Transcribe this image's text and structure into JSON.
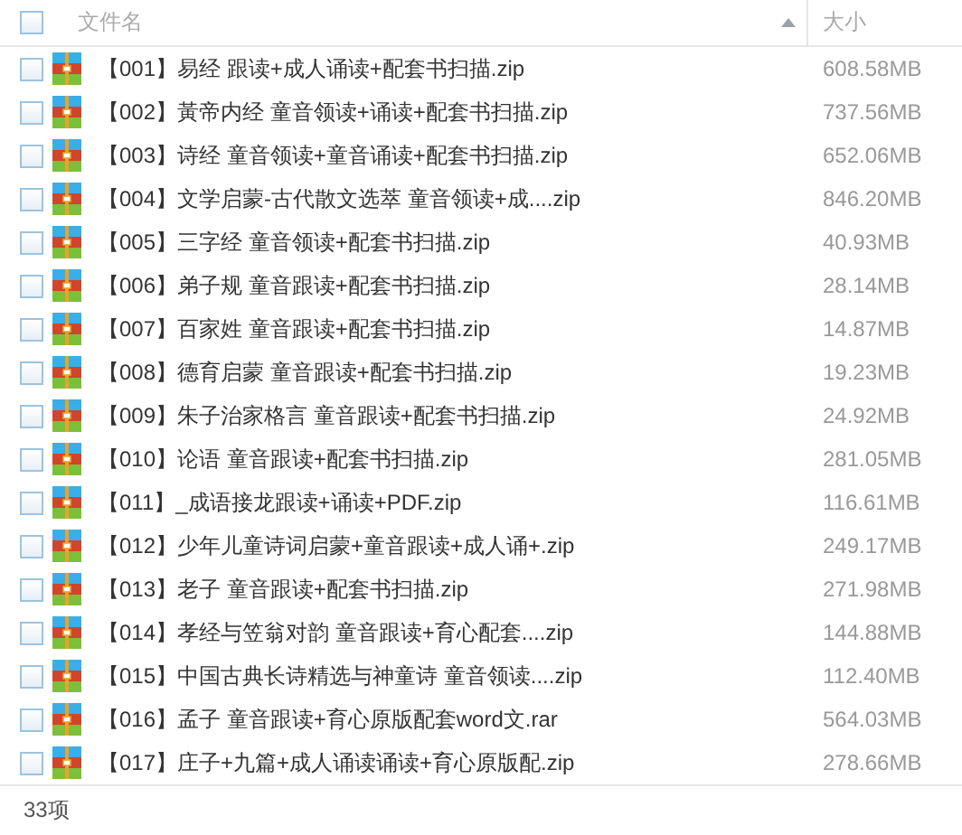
{
  "header": {
    "checked": false,
    "name_column": "文件名",
    "size_column": "大小",
    "sort_ascending": true
  },
  "files": [
    {
      "name": "【001】易经 跟读+成人诵读+配套书扫描.zip",
      "size": "608.58MB",
      "checked": false
    },
    {
      "name": "【002】黃帝内经 童音领读+诵读+配套书扫描.zip",
      "size": "737.56MB",
      "checked": false
    },
    {
      "name": "【003】诗经 童音领读+童音诵读+配套书扫描.zip",
      "size": "652.06MB",
      "checked": false
    },
    {
      "name": "【004】文学启蒙-古代散文选萃 童音领读+成....zip",
      "size": "846.20MB",
      "checked": false
    },
    {
      "name": "【005】三字经 童音领读+配套书扫描.zip",
      "size": "40.93MB",
      "checked": false
    },
    {
      "name": "【006】弟子规 童音跟读+配套书扫描.zip",
      "size": "28.14MB",
      "checked": false
    },
    {
      "name": "【007】百家姓 童音跟读+配套书扫描.zip",
      "size": "14.87MB",
      "checked": false
    },
    {
      "name": "【008】德育启蒙 童音跟读+配套书扫描.zip",
      "size": "19.23MB",
      "checked": false
    },
    {
      "name": "【009】朱子治家格言 童音跟读+配套书扫描.zip",
      "size": "24.92MB",
      "checked": false
    },
    {
      "name": "【010】论语 童音跟读+配套书扫描.zip",
      "size": "281.05MB",
      "checked": false
    },
    {
      "name": "【011】_成语接龙跟读+诵读+PDF.zip",
      "size": "116.61MB",
      "checked": false
    },
    {
      "name": "【012】少年儿童诗词启蒙+童音跟读+成人诵+.zip",
      "size": "249.17MB",
      "checked": false
    },
    {
      "name": "【013】老子 童音跟读+配套书扫描.zip",
      "size": "271.98MB",
      "checked": false
    },
    {
      "name": "【014】孝经与笠翁对韵 童音跟读+育心配套....zip",
      "size": "144.88MB",
      "checked": false
    },
    {
      "name": "【015】中国古典长诗精选与神童诗 童音领读....zip",
      "size": "112.40MB",
      "checked": false
    },
    {
      "name": "【016】孟子 童音跟读+育心原版配套word文.rar",
      "size": "564.03MB",
      "checked": false
    },
    {
      "name": "【017】庄子+九篇+成人诵读诵读+育心原版配.zip",
      "size": "278.66MB",
      "checked": false
    }
  ],
  "status_bar": {
    "count": "33项"
  }
}
